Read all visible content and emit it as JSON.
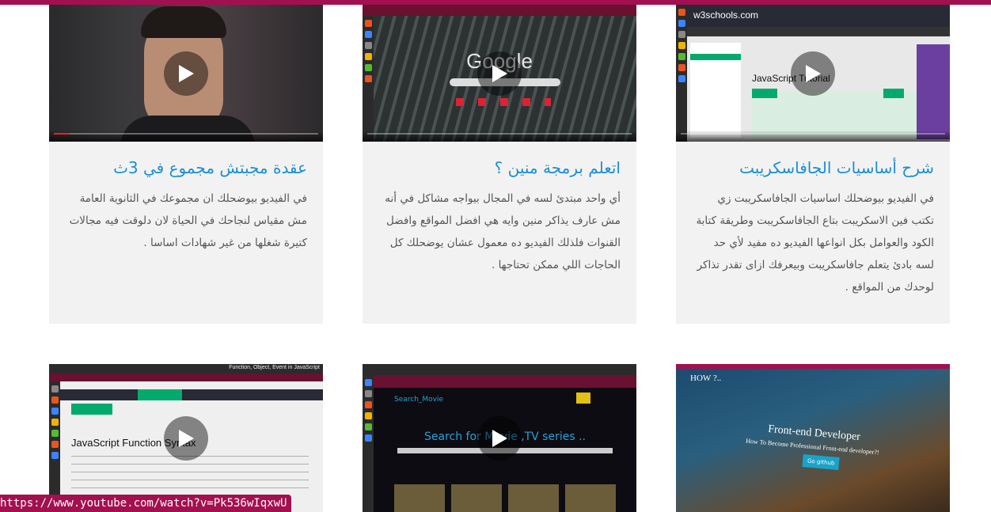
{
  "status_url": "https://www.youtube.com/watch?v=Pk536wIqxwU",
  "colors": {
    "accent": "#a3104f",
    "title": "#1a8fd1",
    "card_bg": "#f2f2f2",
    "text": "#555555"
  },
  "cards": [
    {
      "title": "شرح أساسيات الجافاسكريبت",
      "desc": "في الفيديو بيوضحلك اساسيات الجافاسكريبت زي تكتب فين الاسكريبت بتاع الجافاسكريبت وطريقة كتابة الكود والعوامل بكل انواعها الفيديو ده مفيد لأي حد لسه بادئ يتعلم جافاسكريبت وبيعرفك ازاى تقدر تذاكر لوحدك من المواقع .",
      "thumb_title": "JavaScript Tutorial",
      "thumb_brand": "w3schools.com"
    },
    {
      "title": "اتعلم برمجة منين ؟",
      "desc": "أي واحد مبتدئ لسه في المجال بيواجه مشاكل في أنه مش عارف يذاكر منين وايه هي افضل المواقع وافضل القنوات فلذلك الفيديو ده معمول عشان يوضحلك كل الحاجات اللي ممكن تحتاجها .",
      "thumb_title": "Google"
    },
    {
      "title": "عقدة مجبتش مجموع في 3ث",
      "desc": "في الفيديو بيوضحلك ان مجموعك في الثانوية العامة مش مقياس لنجاحك في الحياة لان دلوقت فيه مجالات كتيرة شغلها من غير شهادات اساسا ."
    }
  ],
  "row2": [
    {
      "thumb_title": "Front-end Developer",
      "thumb_sub": "How To Become Professional Front-end developer?!",
      "brand": "HOW ?..",
      "cta": "Go github"
    },
    {
      "thumb_title": "Search for Movie ,TV series ..",
      "brand": "Search_Movie"
    },
    {
      "thumb_title": "JavaScript Function Syntax",
      "thumb_sub": "Function, Object, Event in JavaScript"
    }
  ]
}
